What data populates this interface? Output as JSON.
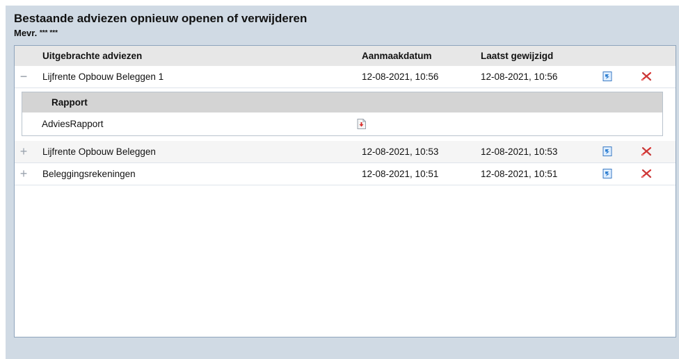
{
  "header": {
    "title": "Bestaande adviezen opnieuw openen of verwijderen",
    "client_prefix": "Mevr.",
    "client_name": "*** ***"
  },
  "table": {
    "columns": [
      "Uitgebrachte adviezen",
      "Aanmaakdatum",
      "Laatst gewijzigd"
    ],
    "rows": [
      {
        "expanded": "−",
        "name": "Lijfrente Opbouw Beleggen 1",
        "created": "12-08-2021, 10:56",
        "modified": "12-08-2021, 10:56"
      },
      {
        "expanded": "+",
        "name": "Lijfrente Opbouw Beleggen",
        "created": "12-08-2021, 10:53",
        "modified": "12-08-2021, 10:53"
      },
      {
        "expanded": "+",
        "name": "Beleggingsrekeningen",
        "created": "12-08-2021, 10:51",
        "modified": "12-08-2021, 10:51"
      }
    ],
    "subtable": {
      "header": "Rapport",
      "items": [
        {
          "name": "AdviesRapport",
          "icon": "pdf-download-icon"
        }
      ]
    },
    "row_icons": {
      "open": "open-document-icon",
      "delete": "delete-x-icon"
    }
  },
  "colors": {
    "background": "#d0dae4",
    "panel_border": "#8ea4bc",
    "header_bg": "#e7e7e7",
    "subheader_bg": "#d4d4d4",
    "delete_red": "#d9302e",
    "open_blue": "#2f7fd0"
  }
}
